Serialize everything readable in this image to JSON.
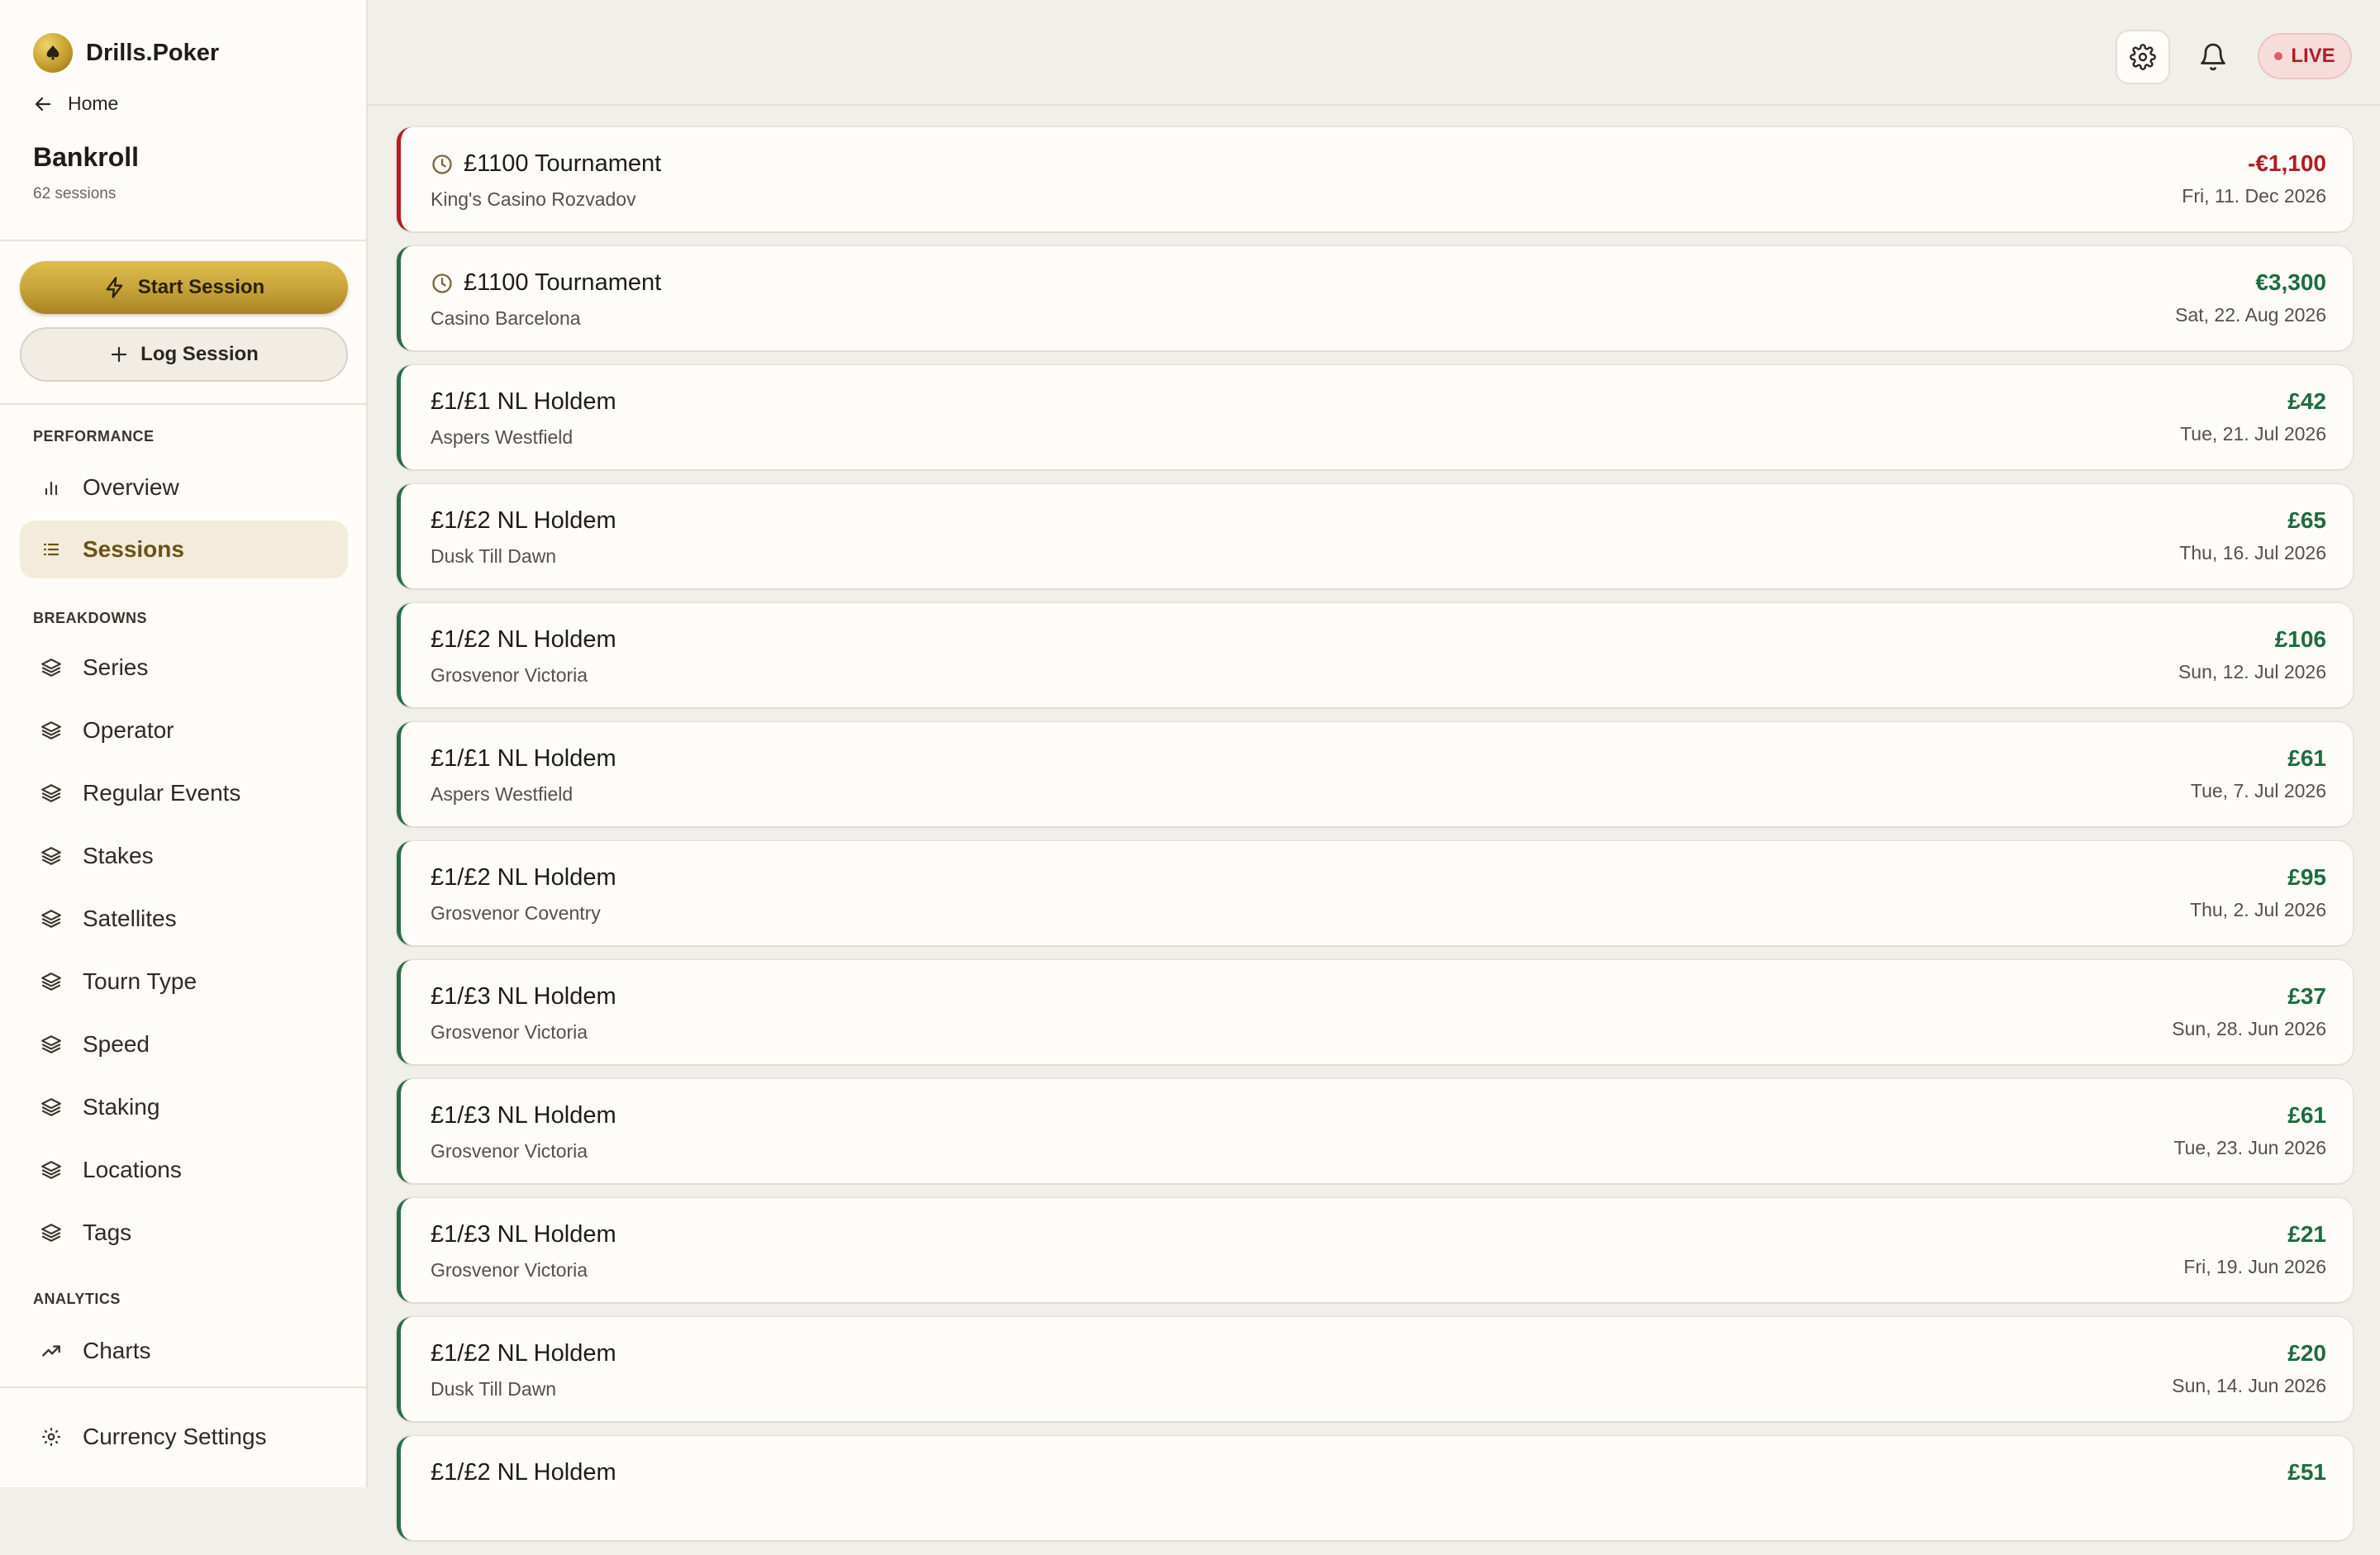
{
  "brand": {
    "name": "Drills.Poker",
    "logo_icon": "spade-coin-icon"
  },
  "nav_back": {
    "label": "Home"
  },
  "page": {
    "title": "Bankroll",
    "subtitle": "62 sessions"
  },
  "actions": {
    "start_label": "Start Session",
    "log_label": "Log Session"
  },
  "sections": {
    "performance": "PERFORMANCE",
    "breakdowns": "BREAKDOWNS",
    "analytics": "ANALYTICS"
  },
  "performance_items": [
    {
      "label": "Overview",
      "icon": "bar-chart-icon"
    },
    {
      "label": "Sessions",
      "icon": "list-icon",
      "active": true
    }
  ],
  "breakdown_items": [
    {
      "label": "Series"
    },
    {
      "label": "Operator"
    },
    {
      "label": "Regular Events"
    },
    {
      "label": "Stakes"
    },
    {
      "label": "Satellites"
    },
    {
      "label": "Tourn Type"
    },
    {
      "label": "Speed"
    },
    {
      "label": "Staking"
    },
    {
      "label": "Locations"
    },
    {
      "label": "Tags"
    }
  ],
  "analytics_items": [
    {
      "label": "Charts",
      "icon": "trend-up-icon"
    }
  ],
  "footer_item": {
    "label": "Currency Settings",
    "icon": "gear-icon"
  },
  "topbar": {
    "live_label": "LIVE"
  },
  "colors": {
    "accent_gold": "#c9a53a",
    "profit_green": "#1f6b40",
    "loss_red": "#b31b22"
  },
  "sessions": [
    {
      "title": "£1100 Tournament",
      "venue": "King's Casino Rozvadov",
      "amount": "-€1,100",
      "date": "Fri, 11. Dec 2026",
      "tournament": true,
      "loss": true
    },
    {
      "title": "£1100 Tournament",
      "venue": "Casino Barcelona",
      "amount": "€3,300",
      "date": "Sat, 22. Aug 2026",
      "tournament": true,
      "loss": false
    },
    {
      "title": "£1/£1 NL Holdem",
      "venue": "Aspers Westfield",
      "amount": "£42",
      "date": "Tue, 21. Jul 2026",
      "tournament": false,
      "loss": false
    },
    {
      "title": "£1/£2 NL Holdem",
      "venue": "Dusk Till Dawn",
      "amount": "£65",
      "date": "Thu, 16. Jul 2026",
      "tournament": false,
      "loss": false
    },
    {
      "title": "£1/£2 NL Holdem",
      "venue": "Grosvenor Victoria",
      "amount": "£106",
      "date": "Sun, 12. Jul 2026",
      "tournament": false,
      "loss": false
    },
    {
      "title": "£1/£1 NL Holdem",
      "venue": "Aspers Westfield",
      "amount": "£61",
      "date": "Tue, 7. Jul 2026",
      "tournament": false,
      "loss": false
    },
    {
      "title": "£1/£2 NL Holdem",
      "venue": "Grosvenor Coventry",
      "amount": "£95",
      "date": "Thu, 2. Jul 2026",
      "tournament": false,
      "loss": false
    },
    {
      "title": "£1/£3 NL Holdem",
      "venue": "Grosvenor Victoria",
      "amount": "£37",
      "date": "Sun, 28. Jun 2026",
      "tournament": false,
      "loss": false
    },
    {
      "title": "£1/£3 NL Holdem",
      "venue": "Grosvenor Victoria",
      "amount": "£61",
      "date": "Tue, 23. Jun 2026",
      "tournament": false,
      "loss": false
    },
    {
      "title": "£1/£3 NL Holdem",
      "venue": "Grosvenor Victoria",
      "amount": "£21",
      "date": "Fri, 19. Jun 2026",
      "tournament": false,
      "loss": false
    },
    {
      "title": "£1/£2 NL Holdem",
      "venue": "Dusk Till Dawn",
      "amount": "£20",
      "date": "Sun, 14. Jun 2026",
      "tournament": false,
      "loss": false
    },
    {
      "title": "£1/£2 NL Holdem",
      "venue": "",
      "amount": "£51",
      "date": "",
      "tournament": false,
      "loss": false
    }
  ]
}
